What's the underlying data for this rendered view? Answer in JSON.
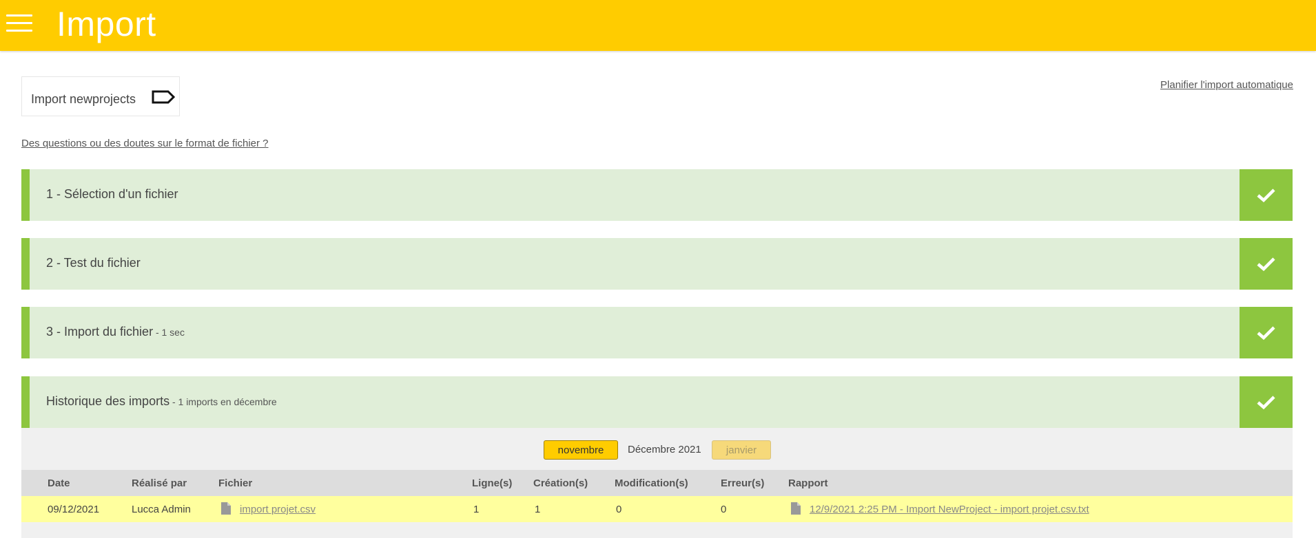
{
  "header": {
    "title": "Import"
  },
  "toolbar": {
    "import_button_label": "Import newprojects",
    "auto_import_link": "Planifier l'import automatique",
    "faq_link": "Des questions ou des doutes sur le format de fichier ?"
  },
  "steps": [
    {
      "title": "1 - Sélection d'un fichier",
      "subtitle": ""
    },
    {
      "title": "2 - Test du fichier",
      "subtitle": ""
    },
    {
      "title": "3 - Import du fichier",
      "subtitle": " - 1 sec"
    },
    {
      "title": "Historique des imports",
      "subtitle": " - 1 imports en décembre"
    }
  ],
  "history": {
    "prev_month": "novembre",
    "current_month": "Décembre 2021",
    "next_month": "janvier",
    "columns": [
      "Date",
      "Réalisé par",
      "Fichier",
      "Ligne(s)",
      "Création(s)",
      "Modification(s)",
      "Erreur(s)",
      "Rapport"
    ],
    "rows": [
      {
        "date": "09/12/2021",
        "by": "Lucca Admin",
        "file": "import projet.csv",
        "lines": "1",
        "created": "1",
        "modified": "0",
        "errors": "0",
        "report": "12/9/2021 2:25 PM - Import NewProject - import projet.csv.txt"
      }
    ]
  },
  "colors": {
    "header": "#ffcc00",
    "success": "#8dc63f",
    "step_bg": "#e0eed8",
    "highlight_row": "#ffff9e"
  },
  "icons": [
    "menu-icon",
    "tag-icon",
    "check-icon",
    "document-icon"
  ]
}
